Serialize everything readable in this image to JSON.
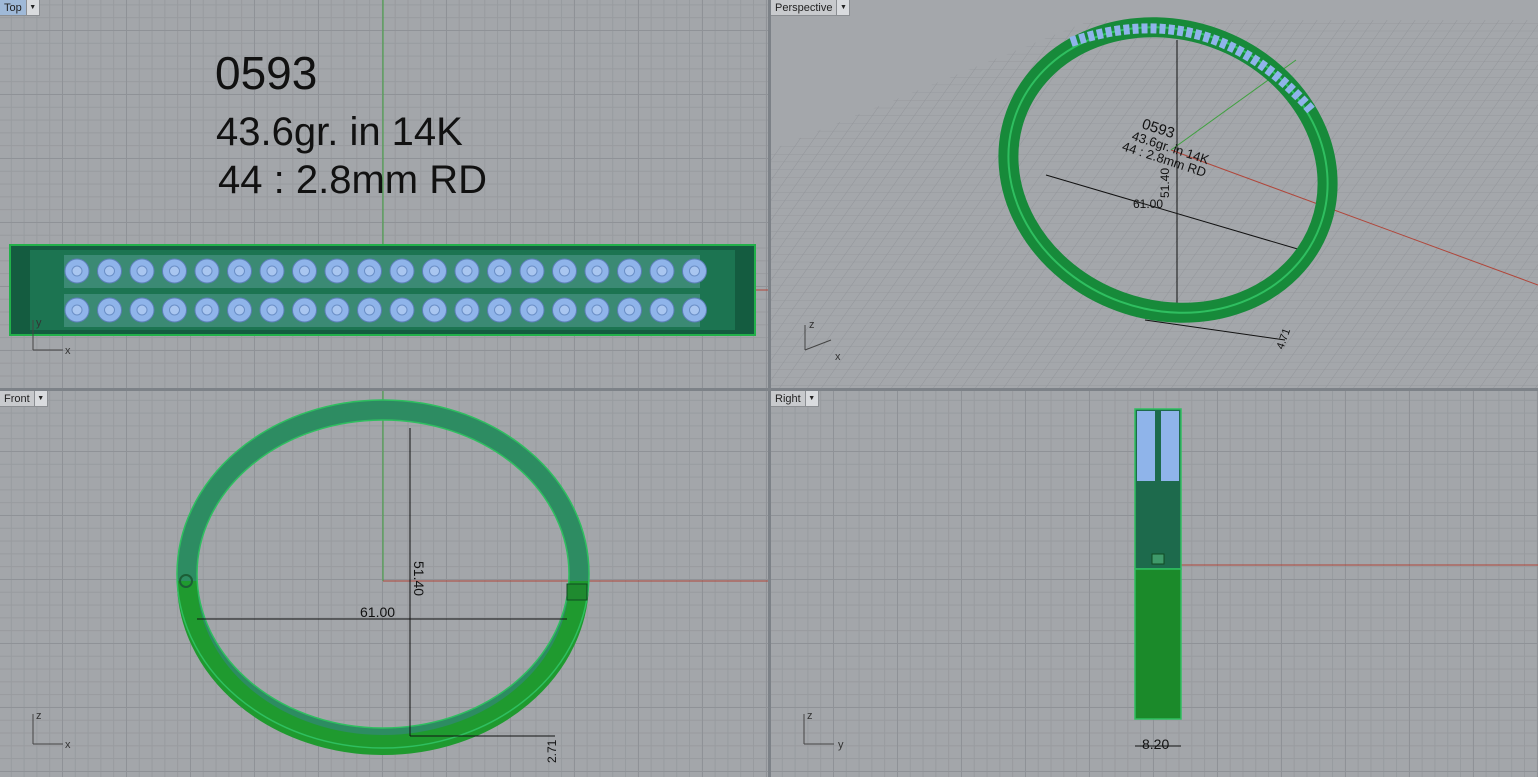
{
  "viewports": {
    "top": {
      "title": "Top",
      "active": true
    },
    "perspective": {
      "title": "Perspective",
      "active": false
    },
    "front": {
      "title": "Front",
      "active": false
    },
    "right": {
      "title": "Right",
      "active": false
    }
  },
  "annotation": {
    "model_number": "0593",
    "weight_line": "43.6gr.  in 14K",
    "stones_line": "44 : 2.8mm RD"
  },
  "perspective_text": {
    "line1": "0593",
    "line2": "43.6gr.  in 14K",
    "line3": "44 : 2.8mm RD"
  },
  "dimensions": {
    "width": "61.00",
    "height": "51.40",
    "thickness": "2.71",
    "band_width": "8.20",
    "persp_thickness": "4.71"
  },
  "axes": {
    "x": "x",
    "y": "y",
    "z": "z"
  },
  "icons": {
    "dropdown": "chevron-down-icon"
  },
  "colors": {
    "viewport_bg": "#a3a6aa",
    "band_green": "#1f8a3a",
    "band_dark": "#0f5a3a",
    "stones": "#8fb4ea",
    "x_axis": "#b0463a",
    "y_axis": "#3fa13f"
  }
}
